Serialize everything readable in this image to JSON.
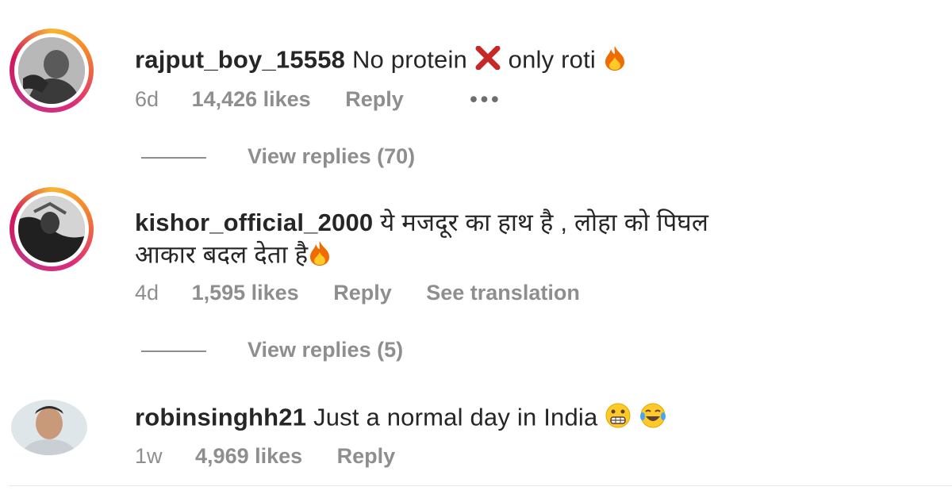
{
  "comments": [
    {
      "username": "rajput_boy_15558",
      "text_a": "No protein",
      "text_b": "only roti",
      "time": "6d",
      "likes": "14,426 likes",
      "reply": "Reply",
      "more": "•••",
      "view_replies": "View replies (70)",
      "emojis": [
        "cross-mark-icon",
        "fire-icon"
      ]
    },
    {
      "username": "kishor_official_2000",
      "text_line1": "ये मजदूर का हाथ है , लोहा को पिघल",
      "text_line2": "आकार बदल देता है",
      "time": "4d",
      "likes": "1,595 likes",
      "reply": "Reply",
      "see_translation": "See translation",
      "view_replies": "View replies (5)",
      "emojis": [
        "fire-icon"
      ]
    },
    {
      "username": "robinsinghh21",
      "text": "Just a normal day in India",
      "time": "1w",
      "likes": "4,969 likes",
      "reply": "Reply",
      "emojis": [
        "grimacing-face-icon",
        "tears-of-joy-icon"
      ]
    }
  ],
  "colors": {
    "story_ring_start": "#f58529",
    "story_ring_end": "#dd2a7b",
    "meta_gray": "#8e8e8e",
    "text": "#262626"
  }
}
